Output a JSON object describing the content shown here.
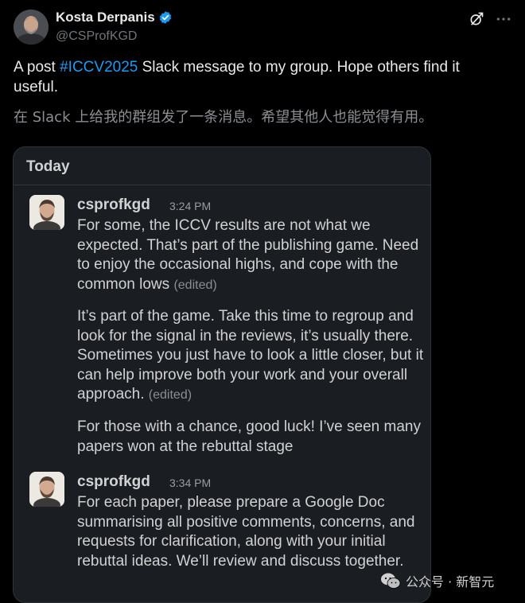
{
  "post": {
    "author_name": "Kosta Derpanis",
    "author_handle": "@CSProfKGD",
    "text_prefix": "A post ",
    "hashtag": "#ICCV2025",
    "text_suffix": " Slack message to my group.  Hope others find it useful.",
    "translation": "在 Slack 上给我的群组发了一条消息。希望其他人也能觉得有用。",
    "icons": [
      "verified-badge-icon",
      "grok-icon",
      "more-options-icon"
    ],
    "accent_color": "#1d9bf0"
  },
  "slack": {
    "day_label": "Today",
    "messages": [
      {
        "user": "csprofkgd",
        "time": "3:24 PM",
        "paragraphs": [
          {
            "text": "For some, the ICCV results are not what we expected.  That’s part of the publishing game.  Need to enjoy the occasional highs, and cope with the common lows",
            "edited": "(edited)"
          },
          {
            "text": "It’s part of the game. Take this time to regroup and look for the signal in the reviews, it’s usually there. Sometimes you just have to look a little closer, but it can help improve both your work and your overall approach.",
            "edited": "(edited)"
          },
          {
            "text": "For those with a chance, good luck!  I’ve seen many papers won at the rebuttal stage",
            "edited": ""
          }
        ]
      },
      {
        "user": "csprofkgd",
        "time": "3:34 PM",
        "paragraphs": [
          {
            "text": "For each paper, please prepare a Google Doc summarising all positive comments, concerns, and requests for clarification, along with your initial rebuttal ideas. We’ll review and discuss together.",
            "edited": ""
          }
        ]
      }
    ]
  },
  "watermark": {
    "text": "公众号 · 新智元",
    "icon": "wechat-icon"
  }
}
